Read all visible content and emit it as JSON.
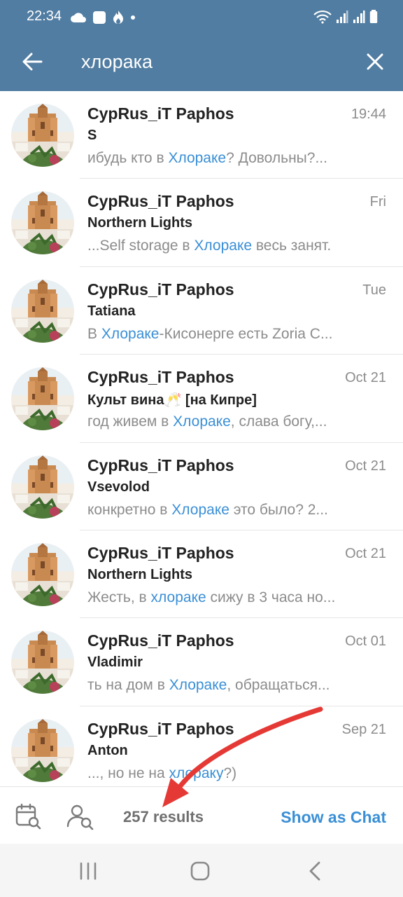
{
  "status_bar": {
    "time": "22:34",
    "left_icons": [
      "cloud-icon",
      "square-app-icon",
      "flame-icon",
      "dot-icon"
    ],
    "right_icons": [
      "wifi-icon",
      "signal-icon",
      "signal-icon",
      "battery-icon"
    ]
  },
  "header": {
    "search_value": "хлорака",
    "back_icon": "arrow-left-icon",
    "close_icon": "close-icon",
    "color": "#517da2"
  },
  "results": [
    {
      "chat": "CypRus_iT Paphos",
      "date": "19:44",
      "sender": "S",
      "pre": "ибудь кто в ",
      "hl": "Хлораке",
      "post": "? Довольны?..."
    },
    {
      "chat": "CypRus_iT Paphos",
      "date": "Fri",
      "sender": "Northern Lights",
      "pre": "...Self storage в ",
      "hl": "Хлораке",
      "post": " весь занят."
    },
    {
      "chat": "CypRus_iT Paphos",
      "date": "Tue",
      "sender": "Tatiana",
      "pre": "В ",
      "hl": "Хлораке",
      "post": "-Кисонерге есть Zoria C..."
    },
    {
      "chat": "CypRus_iT Paphos",
      "date": "Oct 21",
      "sender": "Культ вина🥂 [на Кипре]",
      "pre": "год живем в ",
      "hl": "Хлораке",
      "post": ", слава богу,..."
    },
    {
      "chat": "CypRus_iT Paphos",
      "date": "Oct 21",
      "sender": "Vsevolod",
      "pre": "конкретно в ",
      "hl": "Хлораке",
      "post": " это было?  2..."
    },
    {
      "chat": "CypRus_iT Paphos",
      "date": "Oct 21",
      "sender": "Northern Lights",
      "pre": "Жесть, в ",
      "hl": "хлораке",
      "post": " сижу в 3 часа но..."
    },
    {
      "chat": "CypRus_iT Paphos",
      "date": "Oct 01",
      "sender": "Vladimir",
      "pre": "ть на дом в ",
      "hl": "Хлораке",
      "post": ", обращаться..."
    },
    {
      "chat": "CypRus_iT Paphos",
      "date": "Sep 21",
      "sender": "Anton",
      "pre": "..., но не на ",
      "hl": "хлораку",
      "post": "?)"
    }
  ],
  "bottom_bar": {
    "results_count": "257 results",
    "show_as_chat": "Show as Chat",
    "calendar_icon": "calendar-search-icon",
    "user_icon": "user-search-icon"
  },
  "annotation": {
    "type": "arrow",
    "color": "#e53935"
  },
  "nav_bar": {
    "icons": [
      "recents-icon",
      "home-icon",
      "back-icon"
    ]
  },
  "colors": {
    "accent": "#3a8fd6",
    "highlight": "#3a8fd6",
    "muted": "#8c8c8c",
    "header": "#517da2"
  }
}
